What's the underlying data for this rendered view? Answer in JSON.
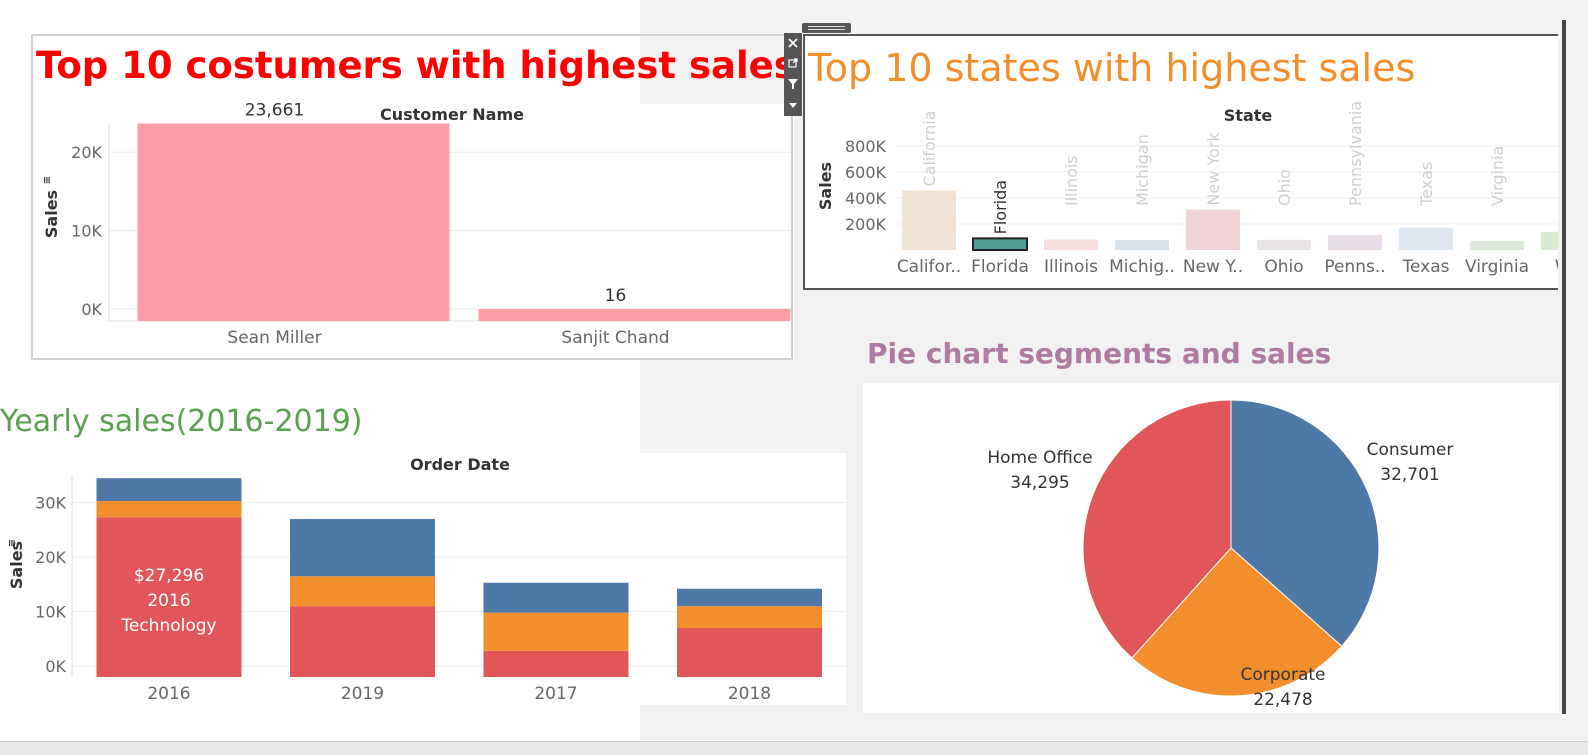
{
  "dashboard": {
    "titles": {
      "customers": "Top 10 costumers with highest sales",
      "states": "Top 10 states with highest sales",
      "yearly": "Yearly sales(2016-2019)",
      "pie": "Pie chart segments and sales"
    },
    "colors": {
      "customers_title": "#ff0000",
      "states_title": "#f28e2b",
      "yearly_title": "#59a14f",
      "pie_title": "#b07aa1"
    },
    "toolbar": [
      "close-icon",
      "open-external-icon",
      "filter-icon",
      "dropdown-icon"
    ]
  },
  "chart_data": [
    {
      "id": "customers",
      "type": "bar",
      "header": "Customer Name",
      "ylabel": "Sales",
      "categories": [
        "Sean Miller",
        "Sanjit Chand"
      ],
      "values": [
        23661,
        16
      ],
      "data_labels": [
        "23,661",
        "16"
      ],
      "yticks": [
        "0K",
        "10K",
        "20K"
      ],
      "ytick_values": [
        0,
        10000,
        20000
      ],
      "ylim": [
        0,
        25000
      ],
      "bar_color": "#ff9da7"
    },
    {
      "id": "states",
      "type": "bar",
      "header": "State",
      "ylabel": "Sales",
      "categories": [
        "California",
        "Florida",
        "Illinois",
        "Michigan",
        "New York",
        "Ohio",
        "Pennsylvania",
        "Texas",
        "Virginia",
        "Washington"
      ],
      "tick_labels": [
        "Califor..",
        "Florida",
        "Illinois",
        "Michig..",
        "New Y..",
        "Ohio",
        "Penns..",
        "Texas",
        "Virginia",
        "Wa"
      ],
      "bar_labels": [
        "California",
        "Florida",
        "Illinois",
        "Michigan",
        "New York",
        "Ohio",
        "Pennsylvania",
        "Texas",
        "Virginia",
        ""
      ],
      "values": [
        457688,
        89474,
        80166,
        76270,
        310876,
        78258,
        116512,
        170188,
        70637,
        138641
      ],
      "highlighted": "Florida",
      "colors": [
        "#f1e2d6",
        "#4e9c96",
        "#f6dede",
        "#dbe3ee",
        "#efd3d7",
        "#e8e4e3",
        "#e8dde6",
        "#dfe7f0",
        "#dde9d8",
        "#d9ead3"
      ],
      "yticks": [
        "200K",
        "400K",
        "600K",
        "800K"
      ],
      "ytick_values": [
        200000,
        400000,
        600000,
        800000
      ],
      "ylim": [
        0,
        900000
      ]
    },
    {
      "id": "yearly",
      "type": "bar",
      "stacked": true,
      "header": "Order Date",
      "ylabel": "Sales",
      "categories": [
        "2016",
        "2019",
        "2017",
        "2018"
      ],
      "series": [
        {
          "name": "Technology",
          "values": [
            27296,
            11000,
            2800,
            7000
          ],
          "color": "#e15759"
        },
        {
          "name": "",
          "values": [
            3000,
            5500,
            7000,
            4000
          ],
          "color": "#f28e2b"
        },
        {
          "name": "",
          "values": [
            4200,
            10500,
            5500,
            3200
          ],
          "color": "#4e79a7"
        }
      ],
      "tooltip_label": {
        "category": "2016",
        "lines": [
          "$27,296",
          "2016",
          "Technology"
        ]
      },
      "yticks": [
        "0K",
        "10K",
        "20K",
        "30K"
      ],
      "ytick_values": [
        0,
        10000,
        20000,
        30000
      ],
      "ylim": [
        -2000,
        36000
      ]
    },
    {
      "id": "segments",
      "type": "pie",
      "categories": [
        "Consumer",
        "Corporate",
        "Home Office"
      ],
      "values": [
        32701,
        22478,
        34295
      ],
      "data_labels": [
        "32,701",
        "22,478",
        "34,295"
      ],
      "colors": [
        "#4e79a7",
        "#f28e2b",
        "#e15759"
      ]
    }
  ]
}
